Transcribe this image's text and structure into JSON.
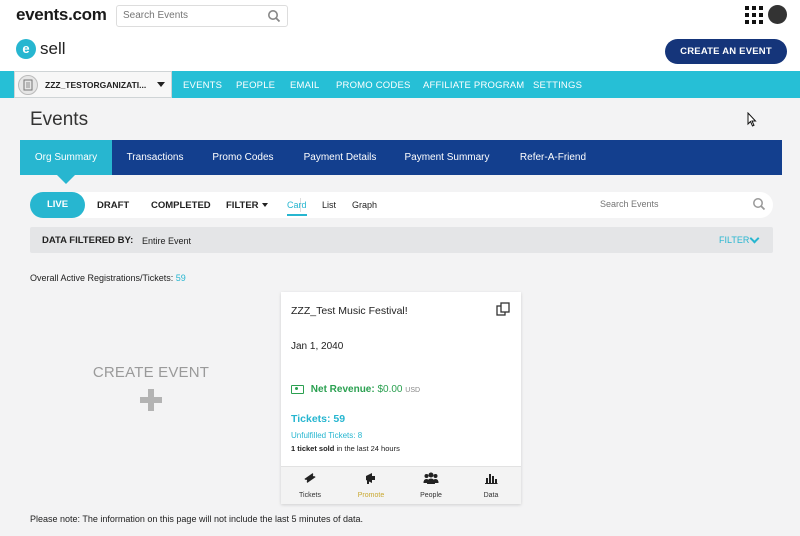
{
  "topbar": {
    "brand": "events.com",
    "search_placeholder": "Search Events"
  },
  "esell": {
    "logo_letter": "e",
    "label": "sell",
    "create_button": "CREATE AN EVENT"
  },
  "nav": {
    "org_name": "ZZZ_TESTORGANIZATI...",
    "links": [
      "EVENTS",
      "PEOPLE",
      "EMAIL",
      "PROMO CODES",
      "AFFILIATE PROGRAM",
      "SETTINGS"
    ]
  },
  "page": {
    "title": "Events"
  },
  "tabs": [
    "Org Summary",
    "Transactions",
    "Promo Codes",
    "Payment Details",
    "Payment Summary",
    "Refer-A-Friend"
  ],
  "filters": {
    "live": "LIVE",
    "draft": "DRAFT",
    "completed": "COMPLETED",
    "filter": "FILTER",
    "views": [
      "Card",
      "List",
      "Graph"
    ],
    "search_placeholder": "Search Events"
  },
  "data_filtered": {
    "label": "DATA FILTERED BY:",
    "value": "Entire Event",
    "filter_link": "FILTER"
  },
  "overall": {
    "label": "Overall Active Registrations/Tickets:",
    "count": "59"
  },
  "create_event": {
    "label": "CREATE EVENT"
  },
  "event_card": {
    "title": "ZZZ_Test Music Festival!",
    "date": "Jan 1, 2040",
    "net_revenue_label": "Net Revenue:",
    "net_revenue_value": "$0.00",
    "currency": "USD",
    "tickets": "Tickets: 59",
    "unfulfilled": "Unfulfilled Tickets: 8",
    "sold_bold": "1 ticket sold",
    "sold_rest": " in the last 24 hours",
    "footer": [
      "Tickets",
      "Promote",
      "People",
      "Data"
    ]
  },
  "note": "Please note: The information on this page will not include the last 5 minutes of data.",
  "colors": {
    "accent": "#27b6d0",
    "navy": "#133f8e",
    "button_navy": "#15357a",
    "revenue_green": "#2aa050"
  }
}
